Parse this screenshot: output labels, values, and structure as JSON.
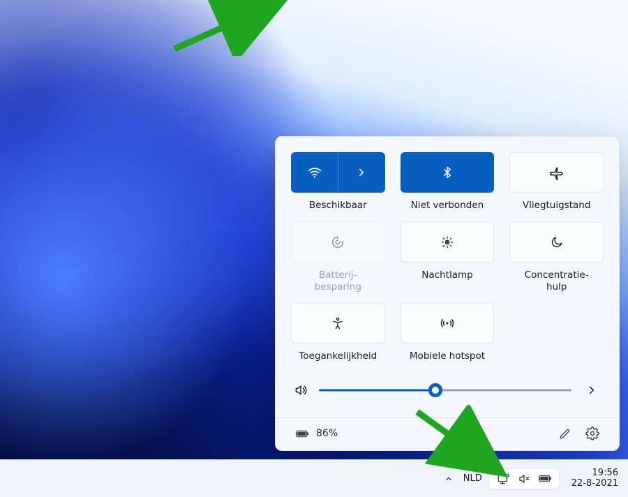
{
  "panel": {
    "tiles": {
      "wifi": {
        "label": "Beschikbaar",
        "state": "active-split"
      },
      "bluetooth": {
        "label": "Niet verbonden",
        "state": "active"
      },
      "airplane": {
        "label": "Vliegtuigstand",
        "state": "off"
      },
      "battery_saver": {
        "label": "Batterij-\nbesparing",
        "state": "disabled"
      },
      "night_light": {
        "label": "Nachtlamp",
        "state": "off"
      },
      "focus": {
        "label": "Concentratie-\nhulp",
        "state": "off"
      },
      "accessibility": {
        "label": "Toegankelijkheid",
        "state": "off"
      },
      "hotspot": {
        "label": "Mobiele hotspot",
        "state": "off"
      }
    },
    "volume": {
      "percent": 46
    },
    "battery": {
      "text": "86%",
      "charging": true
    }
  },
  "taskbar": {
    "language": "NLD",
    "time": "19:56",
    "date": "22-8-2021"
  },
  "colors": {
    "accent": "#0a5ec0",
    "panel_bg": "#f4f7fc",
    "annotation": "#1fa51f"
  }
}
